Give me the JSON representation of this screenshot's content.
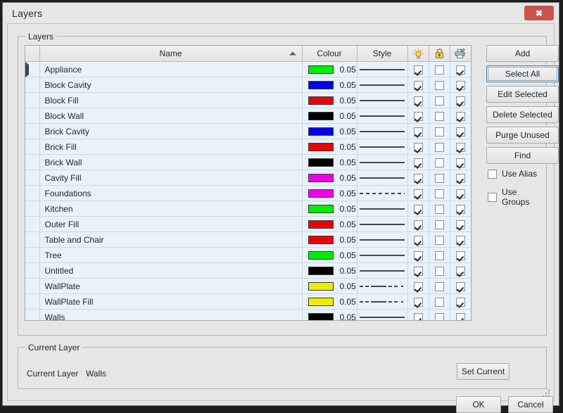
{
  "window": {
    "title": "Layers",
    "close_label": "✖",
    "close_color": "#c9544f"
  },
  "layers_group": {
    "legend": "Layers",
    "columns": {
      "handle": "",
      "name": "Name",
      "colour": "Colour",
      "style": "Style",
      "visible_icon": "lightbulb-icon",
      "lock_icon": "padlock-icon",
      "print_icon": "printer-icon"
    },
    "sort": {
      "column": "Name",
      "direction": "ascending"
    },
    "rows": [
      {
        "marker": true,
        "name": "Appliance",
        "colour": "#00ee00",
        "weight": "0.05",
        "style": "solid",
        "visible": true,
        "locked": false,
        "printable": true
      },
      {
        "marker": false,
        "name": "Block Cavity",
        "colour": "#0000ee",
        "weight": "0.05",
        "style": "solid",
        "visible": true,
        "locked": false,
        "printable": true
      },
      {
        "marker": false,
        "name": "Block Fill",
        "colour": "#ee0000",
        "weight": "0.05",
        "style": "solid",
        "visible": true,
        "locked": false,
        "printable": true
      },
      {
        "marker": false,
        "name": "Block Wall",
        "colour": "#000000",
        "weight": "0.05",
        "style": "solid",
        "visible": true,
        "locked": false,
        "printable": true
      },
      {
        "marker": false,
        "name": "Brick Cavity",
        "colour": "#0000ee",
        "weight": "0.05",
        "style": "solid",
        "visible": true,
        "locked": false,
        "printable": true
      },
      {
        "marker": false,
        "name": "Brick Fill",
        "colour": "#ee0000",
        "weight": "0.05",
        "style": "solid",
        "visible": true,
        "locked": false,
        "printable": true
      },
      {
        "marker": false,
        "name": "Brick Wall",
        "colour": "#000000",
        "weight": "0.05",
        "style": "solid",
        "visible": true,
        "locked": false,
        "printable": true
      },
      {
        "marker": false,
        "name": "Cavity Fill",
        "colour": "#ee00ee",
        "weight": "0.05",
        "style": "solid",
        "visible": true,
        "locked": false,
        "printable": true
      },
      {
        "marker": false,
        "name": "Foundations",
        "colour": "#ee00ee",
        "weight": "0.05",
        "style": "dashed",
        "visible": true,
        "locked": false,
        "printable": true
      },
      {
        "marker": false,
        "name": "Kitchen",
        "colour": "#00ee00",
        "weight": "0.05",
        "style": "solid",
        "visible": true,
        "locked": false,
        "printable": true
      },
      {
        "marker": false,
        "name": "Outer Fill",
        "colour": "#ee0000",
        "weight": "0.05",
        "style": "solid",
        "visible": true,
        "locked": false,
        "printable": true
      },
      {
        "marker": false,
        "name": "Table and Chair",
        "colour": "#ee0000",
        "weight": "0.05",
        "style": "solid",
        "visible": true,
        "locked": false,
        "printable": true
      },
      {
        "marker": false,
        "name": "Tree",
        "colour": "#00ee00",
        "weight": "0.05",
        "style": "solid",
        "visible": true,
        "locked": false,
        "printable": true
      },
      {
        "marker": false,
        "name": "Untitled",
        "colour": "#000000",
        "weight": "0.05",
        "style": "solid",
        "visible": true,
        "locked": false,
        "printable": true
      },
      {
        "marker": false,
        "name": "WallPlate",
        "colour": "#eeee00",
        "weight": "0.05",
        "style": "dashdot",
        "visible": true,
        "locked": false,
        "printable": true
      },
      {
        "marker": false,
        "name": "WallPlate Fill",
        "colour": "#eeee00",
        "weight": "0.05",
        "style": "dashdot",
        "visible": true,
        "locked": false,
        "printable": true
      },
      {
        "marker": false,
        "name": "Walls",
        "colour": "#000000",
        "weight": "0.05",
        "style": "solid",
        "visible": true,
        "locked": false,
        "printable": true
      }
    ],
    "buttons": {
      "add": "Add",
      "select_all": "Select All",
      "edit_selected": "Edit Selected",
      "delete_selected": "Delete Selected",
      "purge_unused": "Purge Unused",
      "find": "Find"
    },
    "focused_button": "Select All",
    "options": [
      {
        "label": "Use Alias",
        "checked": false
      },
      {
        "label": "Use Groups",
        "checked": false
      }
    ]
  },
  "current_layer_group": {
    "legend": "Current Layer",
    "label": "Current Layer",
    "value": "Walls",
    "set_current_label": "Set Current"
  },
  "footer": {
    "ok_label": "OK",
    "cancel_label": "Cancel"
  }
}
